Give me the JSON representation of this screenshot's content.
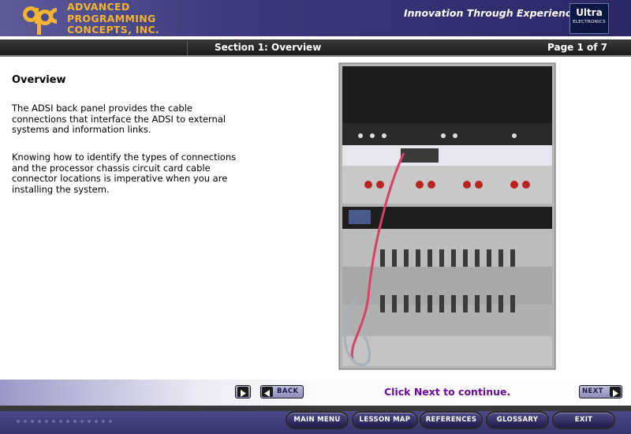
{
  "header": {
    "company_lines": [
      "ADVANCED",
      "PROGRAMMING",
      "CONCEPTS, INC."
    ],
    "logo_text": "apc",
    "tagline": "Innovation Through Experience",
    "badge": {
      "top": "Ultra",
      "bottom": "ELECTRONICS"
    }
  },
  "section_bar": {
    "title": "Section 1: Overview",
    "page": "Page 1 of 7"
  },
  "content": {
    "heading": "Overview",
    "paragraphs": [
      "The ADSI back panel provides the cable connections that interface the ADSI to external systems and information links.",
      "Knowing how to identify the types of connections and the processor chassis circuit card cable connector locations is imperative when you are installing the system."
    ],
    "image": {
      "icon": "equipment-rack-photo"
    }
  },
  "navigation": {
    "back_label": "BACK",
    "next_label": "NEXT",
    "instruction": "Click Next to continue."
  },
  "menu": {
    "items": [
      "MAIN MENU",
      "LESSON MAP",
      "REFERENCES",
      "GLOSSARY",
      "EXIT"
    ]
  },
  "colors": {
    "brand_gold": "#f2b431",
    "header_purple": "#3d3b7e",
    "instruction_purple": "#6a0a99"
  }
}
